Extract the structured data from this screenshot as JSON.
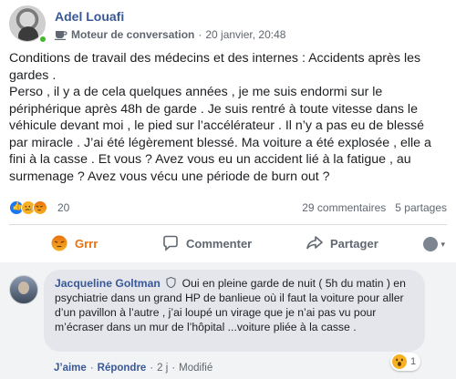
{
  "post": {
    "author": "Adel Louafi",
    "group": "Moteur de conversation",
    "separator": "·",
    "timestamp": "20 janvier, 20:48",
    "paragraphs": [
      "Conditions de travail des médecins et des internes : Accidents après les gardes .",
      "Perso , il y a de cela quelques années , je me suis endormi sur le périphérique après 48h de garde . Je suis rentré à toute vitesse dans le véhicule devant moi , le pied sur l’accélérateur . Il n’y a pas eu de blessé par miracle . J’ai été légèrement blessé. Ma voiture a été explosée , elle a fini à la casse . Et vous ? Avez vous eu un accident lié à la fatigue , au surmenage ? Avez vous vécu une période de burn out ?"
    ],
    "reaction_count": "20",
    "comments_count": "29 commentaires",
    "shares_count": "5 partages"
  },
  "actions": {
    "reaction_label": "Grrr",
    "comment_label": "Commenter",
    "share_label": "Partager",
    "view_as_caret": "▾"
  },
  "comment": {
    "author": "Jacqueline Goltman",
    "text": "Oui en pleine garde de nuit ( 5h du matin ) en psychiatrie dans un grand HP de banlieue où il faut la voiture pour aller d’un pavillon à l’autre , j’ai loupé un virage que je n’ai pas vu pour m’écraser dans un mur de l’hôpital ...voiture pliée à la casse .",
    "like_label": "J’aime",
    "reply_label": "Répondre",
    "dot": "·",
    "age": "2 j",
    "edited": "Modifié",
    "reaction_count": "1"
  },
  "colors": {
    "link_blue": "#385898",
    "like_blue": "#1877f2",
    "angry_orange": "#e9710f",
    "emoji_yellow": "#f7b125",
    "online_green": "#42b72a"
  },
  "icons": [
    "coffee-icon",
    "like-icon",
    "sad-icon",
    "angry-icon",
    "comment-icon",
    "share-icon",
    "shield-icon",
    "wow-icon"
  ]
}
